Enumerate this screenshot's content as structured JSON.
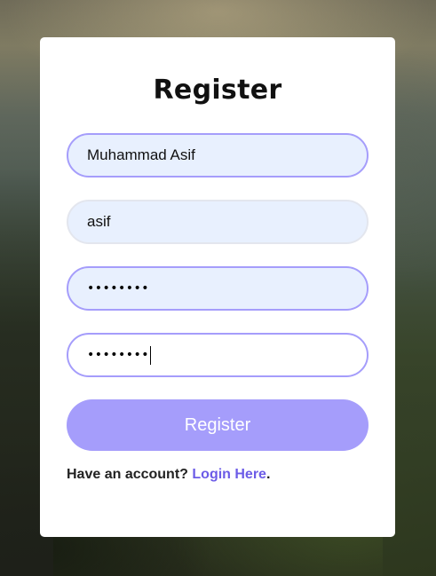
{
  "form": {
    "title": "Register",
    "fullname_value": "Muhammad Asif",
    "username_value": "asif",
    "password_masked": "••••••••",
    "confirm_password_masked": "••••••••",
    "submit_label": "Register"
  },
  "footer": {
    "prompt": "Have an account?",
    "link_label": "Login Here",
    "suffix": "."
  },
  "colors": {
    "accent": "#a59dfb",
    "link": "#6c5ce7",
    "input_fill": "#e8f0fe"
  }
}
